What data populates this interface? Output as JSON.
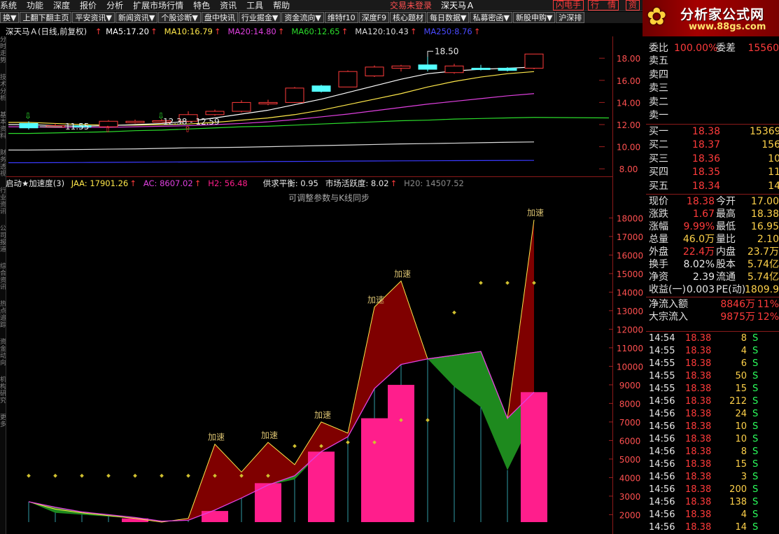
{
  "menu": {
    "items": [
      "系统",
      "功能",
      "深度",
      "报价",
      "分析",
      "扩展市场行情",
      "特色",
      "资讯",
      "工具",
      "帮助"
    ],
    "status": "交易未登录",
    "stock_name": "深天马Ａ",
    "flash_btn": "闪电手",
    "quote_btn": "行　情",
    "trade_btn": "资"
  },
  "toolbar": {
    "buttons": [
      "换▼",
      "上翻下翻主页",
      "平安资讯▼",
      "新闻资讯▼",
      "个股诊断▼",
      "盘中快讯",
      "行业掘金▼",
      "资金流向▼",
      "维特f10",
      "深度F9",
      "核心题材",
      "每日数据▼",
      "私募密函▼",
      "新股申购▼",
      "沪深排"
    ]
  },
  "logo": {
    "title": "分析家公式网",
    "url_text": "www.88gs.com"
  },
  "left_tabs": [
    "分时走势",
    "技术分析",
    "基本资料",
    "财务透视",
    "行业资讯",
    "公司报道",
    "综合资讯",
    "热点追踪",
    "资金动向",
    "机构研究",
    "更多"
  ],
  "colors": {
    "ma5": "#ffffff",
    "ma10": "#ffe84a",
    "ma20": "#e040e0",
    "ma60": "#2bdc2b",
    "ma120": "#dcdcdc",
    "ma250": "#3a3aff",
    "candle_up": "#ff3b3b",
    "candle_down": "#54ffff",
    "area_red": "#7f0000",
    "area_green": "#1e8a1e",
    "bar_pink": "#ff1e8c",
    "dot": "#d0c030"
  },
  "kline": {
    "title": "深天马Ａ(日线,前复权)",
    "indicators": [
      {
        "label": "MA5:",
        "value": "17.20",
        "color": "#ffffff"
      },
      {
        "label": "MA10:",
        "value": "16.79",
        "color": "#ffe84a"
      },
      {
        "label": "MA20:",
        "value": "14.80",
        "color": "#e040e0"
      },
      {
        "label": "MA60:",
        "value": "12.65",
        "color": "#2bdc2b"
      },
      {
        "label": "MA120:",
        "value": "10.43",
        "color": "#dcdcdc"
      },
      {
        "label": "MA250:",
        "value": "8.76",
        "color": "#4a4aff"
      }
    ],
    "y_labels": [
      "18.00",
      "16.00",
      "14.00",
      "12.00",
      "10.00",
      "8.00"
    ],
    "y_values": [
      18,
      16,
      14,
      12,
      10,
      8
    ],
    "annotations": {
      "high": "18.50",
      "low": "11.55",
      "range": "12.38 - 12.59"
    },
    "candles": [
      {
        "o": 12.1,
        "c": 11.7,
        "h": 12.3,
        "l": 11.55
      },
      {
        "o": 11.9,
        "c": 11.9,
        "h": 12.1,
        "l": 11.75
      },
      {
        "o": 11.9,
        "c": 11.8,
        "h": 12.05,
        "l": 11.7
      },
      {
        "o": 11.8,
        "c": 12.3,
        "h": 12.4,
        "l": 11.65
      },
      {
        "o": 12.2,
        "c": 12.3,
        "h": 12.45,
        "l": 12.1
      },
      {
        "o": 12.3,
        "c": 12.35,
        "h": 12.5,
        "l": 12.2
      },
      {
        "o": 12.3,
        "c": 12.9,
        "h": 13.2,
        "l": 12.2
      },
      {
        "o": 12.9,
        "c": 13.2,
        "h": 13.35,
        "l": 12.8
      },
      {
        "o": 13.2,
        "c": 14.0,
        "h": 14.2,
        "l": 13.1
      },
      {
        "o": 13.9,
        "c": 14.0,
        "h": 14.25,
        "l": 13.75
      },
      {
        "o": 14.0,
        "c": 15.3,
        "h": 15.4,
        "l": 13.95
      },
      {
        "o": 15.5,
        "c": 15.0,
        "h": 15.6,
        "l": 14.9
      },
      {
        "o": 15.4,
        "c": 16.8,
        "h": 16.9,
        "l": 15.4
      },
      {
        "o": 16.4,
        "c": 17.2,
        "h": 17.35,
        "l": 16.3
      },
      {
        "o": 17.1,
        "c": 17.3,
        "h": 17.4,
        "l": 16.8
      },
      {
        "o": 17.4,
        "c": 17.0,
        "h": 18.5,
        "l": 16.8
      },
      {
        "o": 16.7,
        "c": 17.3,
        "h": 17.5,
        "l": 16.6
      },
      {
        "o": 17.1,
        "c": 17.0,
        "h": 17.4,
        "l": 16.9
      },
      {
        "o": 17.1,
        "c": 16.9,
        "h": 17.2,
        "l": 16.8
      },
      {
        "o": 17.1,
        "c": 18.38,
        "h": 18.38,
        "l": 17.0
      }
    ],
    "ma5": [
      12.0,
      11.9,
      11.85,
      11.9,
      12.0,
      12.1,
      12.3,
      12.6,
      12.95,
      13.3,
      13.8,
      14.3,
      14.9,
      15.5,
      16.1,
      16.6,
      16.85,
      17.0,
      17.1,
      17.2
    ],
    "ma10": [
      12.2,
      12.1,
      12.0,
      11.95,
      11.95,
      12.0,
      12.05,
      12.2,
      12.4,
      12.6,
      12.9,
      13.3,
      13.8,
      14.3,
      14.8,
      15.4,
      15.9,
      16.3,
      16.6,
      16.79
    ],
    "ma20": [
      11.8,
      11.75,
      11.75,
      11.75,
      11.8,
      11.85,
      11.9,
      12.0,
      12.1,
      12.25,
      12.45,
      12.7,
      12.95,
      13.25,
      13.55,
      13.85,
      14.1,
      14.35,
      14.6,
      14.8
    ],
    "ma60": [
      11.2,
      11.25,
      11.3,
      11.35,
      11.45,
      11.5,
      11.6,
      11.7,
      11.8,
      11.85,
      11.95,
      12.05,
      12.15,
      12.25,
      12.35,
      12.4,
      12.5,
      12.55,
      12.6,
      12.65
    ],
    "ma120": [
      9.7,
      9.72,
      9.75,
      9.78,
      9.8,
      9.85,
      9.9,
      9.92,
      9.95,
      10.0,
      10.05,
      10.1,
      10.15,
      10.2,
      10.25,
      10.28,
      10.32,
      10.36,
      10.4,
      10.43
    ],
    "ma250": [
      8.55,
      8.56,
      8.57,
      8.58,
      8.6,
      8.61,
      8.62,
      8.63,
      8.64,
      8.66,
      8.67,
      8.68,
      8.7,
      8.71,
      8.72,
      8.73,
      8.74,
      8.75,
      8.755,
      8.76
    ]
  },
  "sub": {
    "title": "启动★加速度(3)",
    "indicators": [
      {
        "label": "JAA:",
        "value": "17901.26",
        "color": "#ffe84a",
        "arrow": true
      },
      {
        "label": "AC:",
        "value": "8607.02",
        "color": "#e040e0",
        "arrow": true
      },
      {
        "label": "H2:",
        "value": "56.48",
        "color": "#ff1e8c",
        "arrow": false
      }
    ],
    "extra": [
      {
        "label": "供求平衡:",
        "value": "0.95",
        "color": "#e8e8e8"
      },
      {
        "label": "市场活跃度:",
        "value": "8.02",
        "color": "#e8e8e8",
        "arrow": true
      },
      {
        "label": "H20:",
        "value": "14507.52",
        "color": "#8a8a8a"
      }
    ],
    "note": "可调整参数与K线同步",
    "accel_label": "加速",
    "y_labels": [
      "18000",
      "17000",
      "16000",
      "15000",
      "14000",
      "13000",
      "12000",
      "11000",
      "10000",
      "9000",
      "8000",
      "7000",
      "6000",
      "5000",
      "4000",
      "3000",
      "2000"
    ],
    "y_values": [
      18000,
      17000,
      16000,
      15000,
      14000,
      13000,
      12000,
      11000,
      10000,
      9000,
      8000,
      7000,
      6000,
      5000,
      4000,
      3000,
      2000
    ],
    "jaa": [
      2700,
      2300,
      2100,
      1950,
      1800,
      1600,
      1800,
      5800,
      4300,
      5900,
      4700,
      7000,
      6400,
      13200,
      14600,
      10400,
      10600,
      10800,
      7200,
      17901
    ],
    "ac": [
      2700,
      2400,
      2150,
      2000,
      1850,
      1650,
      1700,
      2250,
      2900,
      3600,
      4100,
      5400,
      6200,
      8800,
      10100,
      10400,
      10600,
      10800,
      7200,
      8607
    ],
    "green_low": [
      2700,
      2100,
      2000,
      1900,
      1800,
      1650,
      1700,
      2250,
      2900,
      3600,
      3900,
      5400,
      6200,
      8800,
      10100,
      10400,
      8900,
      7800,
      4400,
      7300
    ],
    "h2": [
      0,
      0,
      0,
      0,
      1800,
      1100,
      1500,
      2200,
      0,
      3700,
      0,
      5400,
      0,
      7200,
      9000,
      0,
      0,
      0,
      0,
      8607
    ],
    "dots": [
      4100,
      4100,
      4100,
      4100,
      4100,
      4100,
      4100,
      4100,
      4100,
      4100,
      5700,
      5700,
      5900,
      5900,
      7100,
      7100,
      12900,
      14500,
      14500,
      14500
    ],
    "accel_marks": [
      7,
      9,
      11,
      13,
      14,
      19
    ]
  },
  "quote": {
    "committee_ratio_label": "委比",
    "committee_ratio": "100.00%",
    "committee_diff_label": "委差",
    "committee_diff": "15560",
    "sell": [
      {
        "label": "卖五",
        "price": "",
        "vol": ""
      },
      {
        "label": "卖四",
        "price": "",
        "vol": ""
      },
      {
        "label": "卖三",
        "price": "",
        "vol": ""
      },
      {
        "label": "卖二",
        "price": "",
        "vol": ""
      },
      {
        "label": "卖一",
        "price": "",
        "vol": ""
      }
    ],
    "buy": [
      {
        "label": "买一",
        "price": "18.38",
        "vol": "15369"
      },
      {
        "label": "买二",
        "price": "18.37",
        "vol": "156"
      },
      {
        "label": "买三",
        "price": "18.36",
        "vol": "10"
      },
      {
        "label": "买四",
        "price": "18.35",
        "vol": "11"
      },
      {
        "label": "买五",
        "price": "18.34",
        "vol": "14"
      }
    ],
    "stats": [
      {
        "l1": "现价",
        "v1": "18.38",
        "c1": "red",
        "l2": "今开",
        "v2": "17.00",
        "c2": "red"
      },
      {
        "l1": "涨跌",
        "v1": "1.67",
        "c1": "red",
        "l2": "最高",
        "v2": "18.38",
        "c2": "red"
      },
      {
        "l1": "涨幅",
        "v1": "9.99%",
        "c1": "red",
        "l2": "最低",
        "v2": "16.95",
        "c2": "red"
      },
      {
        "l1": "总量",
        "v1": "46.0万",
        "c1": "yel",
        "l2": "量比",
        "v2": "2.10",
        "c2": "red"
      },
      {
        "l1": "外盘",
        "v1": "22.4万",
        "c1": "red",
        "l2": "内盘",
        "v2": "23.7万",
        "c2": "grn"
      },
      {
        "l1": "换手",
        "v1": "8.02%",
        "c1": "wht",
        "l2": "股本",
        "v2": "5.74亿",
        "c2": "wht"
      },
      {
        "l1": "净资",
        "v1": "2.39",
        "c1": "wht",
        "l2": "流通",
        "v2": "5.74亿",
        "c2": "wht"
      },
      {
        "l1": "收益(一)",
        "v1": "0.003",
        "c1": "wht",
        "l2": "PE(动)",
        "v2": "1809.9",
        "c2": "wht"
      }
    ],
    "flows": [
      {
        "label": "净流入额",
        "value": "8846万",
        "pct": "11%"
      },
      {
        "label": "大宗流入",
        "value": "9875万",
        "pct": "12%"
      }
    ]
  },
  "ticks": [
    {
      "time": "14:54",
      "price": "18.38",
      "vol": "8",
      "side": "S"
    },
    {
      "time": "14:55",
      "price": "18.38",
      "vol": "4",
      "side": "S"
    },
    {
      "time": "14:55",
      "price": "18.38",
      "vol": "6",
      "side": "S"
    },
    {
      "time": "14:55",
      "price": "18.38",
      "vol": "50",
      "side": "S"
    },
    {
      "time": "14:55",
      "price": "18.38",
      "vol": "15",
      "side": "S"
    },
    {
      "time": "14:56",
      "price": "18.38",
      "vol": "212",
      "side": "S"
    },
    {
      "time": "14:56",
      "price": "18.38",
      "vol": "24",
      "side": "S"
    },
    {
      "time": "14:56",
      "price": "18.38",
      "vol": "10",
      "side": "S"
    },
    {
      "time": "14:56",
      "price": "18.38",
      "vol": "10",
      "side": "S"
    },
    {
      "time": "14:56",
      "price": "18.38",
      "vol": "8",
      "side": "S"
    },
    {
      "time": "14:56",
      "price": "18.38",
      "vol": "15",
      "side": "S"
    },
    {
      "time": "14:56",
      "price": "18.38",
      "vol": "3",
      "side": "S"
    },
    {
      "time": "14:56",
      "price": "18.38",
      "vol": "200",
      "side": "S"
    },
    {
      "time": "14:56",
      "price": "18.38",
      "vol": "138",
      "side": "S"
    },
    {
      "time": "14:56",
      "price": "18.38",
      "vol": "4",
      "side": "S"
    },
    {
      "time": "14:56",
      "price": "18.38",
      "vol": "14",
      "side": "S"
    }
  ]
}
